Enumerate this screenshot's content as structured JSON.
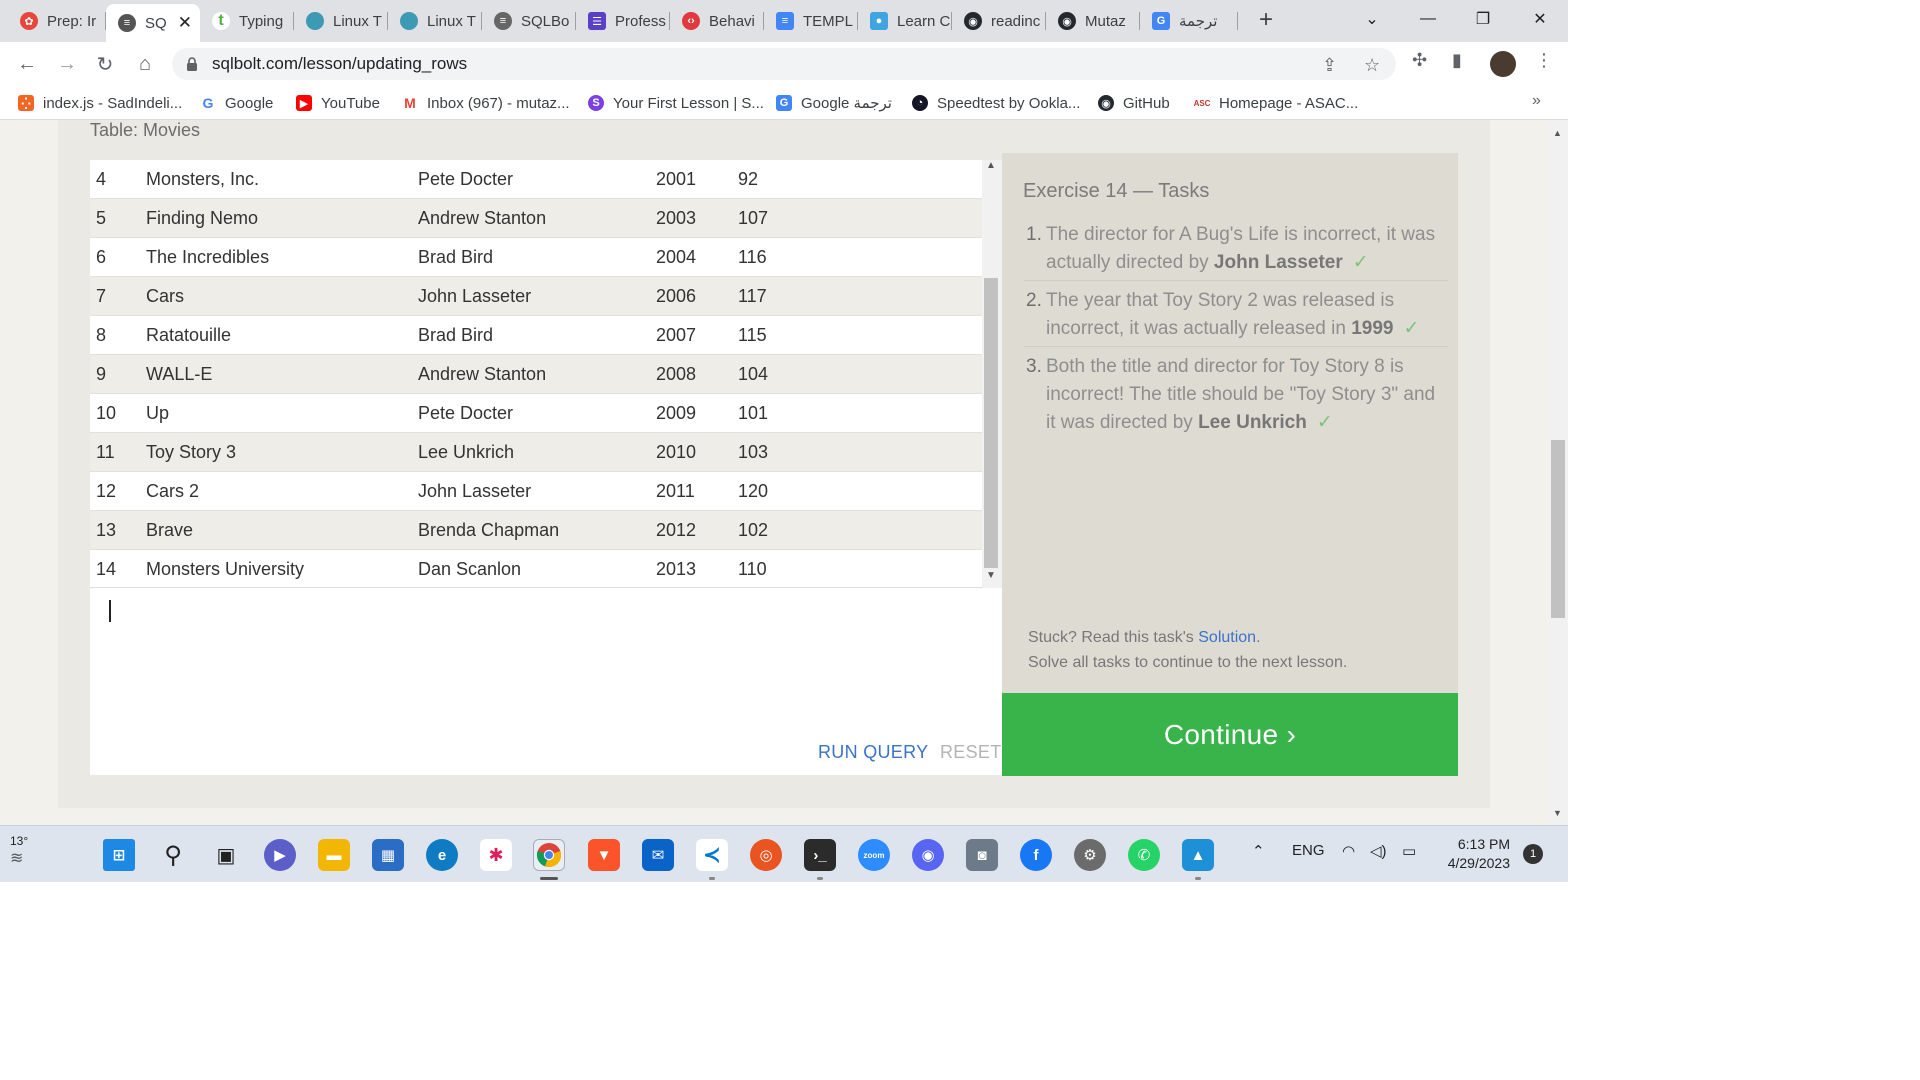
{
  "browser": {
    "tabs": [
      {
        "label": "Prep: Ir",
        "color": "#e8453c"
      },
      {
        "label": "SQ",
        "color": "#555555",
        "active": true
      },
      {
        "label": "Typing",
        "color": "#52b043"
      },
      {
        "label": "Linux T",
        "color": "#3d9ab5"
      },
      {
        "label": "Linux T",
        "color": "#3d9ab5"
      },
      {
        "label": "SQLBo",
        "color": "#666666"
      },
      {
        "label": "Profess",
        "color": "#5b3fc4"
      },
      {
        "label": "Behavi",
        "color": "#e0393e"
      },
      {
        "label": "TEMPL",
        "color": "#4285f4"
      },
      {
        "label": "Learn C",
        "color": "#3fa4e0"
      },
      {
        "label": "readinc",
        "color": "#24292f"
      },
      {
        "label": "Mutaz",
        "color": "#24292f"
      },
      {
        "label": "ترجمة",
        "color": "#4285f4"
      }
    ],
    "url": "sqlbolt.com/lesson/updating_rows"
  },
  "bookmarks": [
    {
      "label": "index.js - SadIndeli...",
      "color": "#f26522"
    },
    {
      "label": "Google",
      "color": "#4285f4"
    },
    {
      "label": "YouTube",
      "color": "#ff0000"
    },
    {
      "label": "Inbox (967) - mutaz...",
      "color": "#ea4335"
    },
    {
      "label": "Your First Lesson | S...",
      "color": "#7b3fe4"
    },
    {
      "label": "Google ترجمة",
      "color": "#4285f4"
    },
    {
      "label": "Speedtest by Ookla...",
      "color": "#141526"
    },
    {
      "label": "GitHub",
      "color": "#24292f"
    },
    {
      "label": "Homepage - ASAC...",
      "color": "#c0392b"
    }
  ],
  "lesson": {
    "table_caption": "Table: Movies",
    "rows": [
      {
        "id": "4",
        "title": "Monsters, Inc.",
        "director": "Pete Docter",
        "year": "2001",
        "length": "92"
      },
      {
        "id": "5",
        "title": "Finding Nemo",
        "director": "Andrew Stanton",
        "year": "2003",
        "length": "107"
      },
      {
        "id": "6",
        "title": "The Incredibles",
        "director": "Brad Bird",
        "year": "2004",
        "length": "116"
      },
      {
        "id": "7",
        "title": "Cars",
        "director": "John Lasseter",
        "year": "2006",
        "length": "117"
      },
      {
        "id": "8",
        "title": "Ratatouille",
        "director": "Brad Bird",
        "year": "2007",
        "length": "115"
      },
      {
        "id": "9",
        "title": "WALL-E",
        "director": "Andrew Stanton",
        "year": "2008",
        "length": "104"
      },
      {
        "id": "10",
        "title": "Up",
        "director": "Pete Docter",
        "year": "2009",
        "length": "101"
      },
      {
        "id": "11",
        "title": "Toy Story 3",
        "director": "Lee Unkrich",
        "year": "2010",
        "length": "103"
      },
      {
        "id": "12",
        "title": "Cars 2",
        "director": "John Lasseter",
        "year": "2011",
        "length": "120"
      },
      {
        "id": "13",
        "title": "Brave",
        "director": "Brenda Chapman",
        "year": "2012",
        "length": "102"
      },
      {
        "id": "14",
        "title": "Monsters University",
        "director": "Dan Scanlon",
        "year": "2013",
        "length": "110"
      }
    ],
    "run_query": "RUN QUERY",
    "reset": "RESET"
  },
  "tasks": {
    "title": "Exercise 14 — Tasks",
    "items": [
      {
        "num": "1.",
        "text": "The director for A Bug's Life is incorrect, it was actually directed by ",
        "bold": "John Lasseter",
        "check": "✓"
      },
      {
        "num": "2.",
        "text": "The year that Toy Story 2 was released is incorrect, it was actually released in ",
        "bold": "1999",
        "check": "✓"
      },
      {
        "num": "3.",
        "text": "Both the title and director for Toy Story 8 is incorrect! The title should be \"Toy Story 3\" and it was directed by ",
        "bold": "Lee Unkrich",
        "check": "✓"
      }
    ],
    "stuck_prefix": "Stuck? Read this task's ",
    "solution_link": "Solution",
    "stuck_suffix": ".",
    "solve_all": "Solve all tasks to continue to the next lesson.",
    "continue": "Continue ›"
  },
  "taskbar": {
    "temperature": "13°",
    "language": "ENG",
    "time": "6:13 PM",
    "date": "4/29/2023",
    "notifications": "1"
  }
}
